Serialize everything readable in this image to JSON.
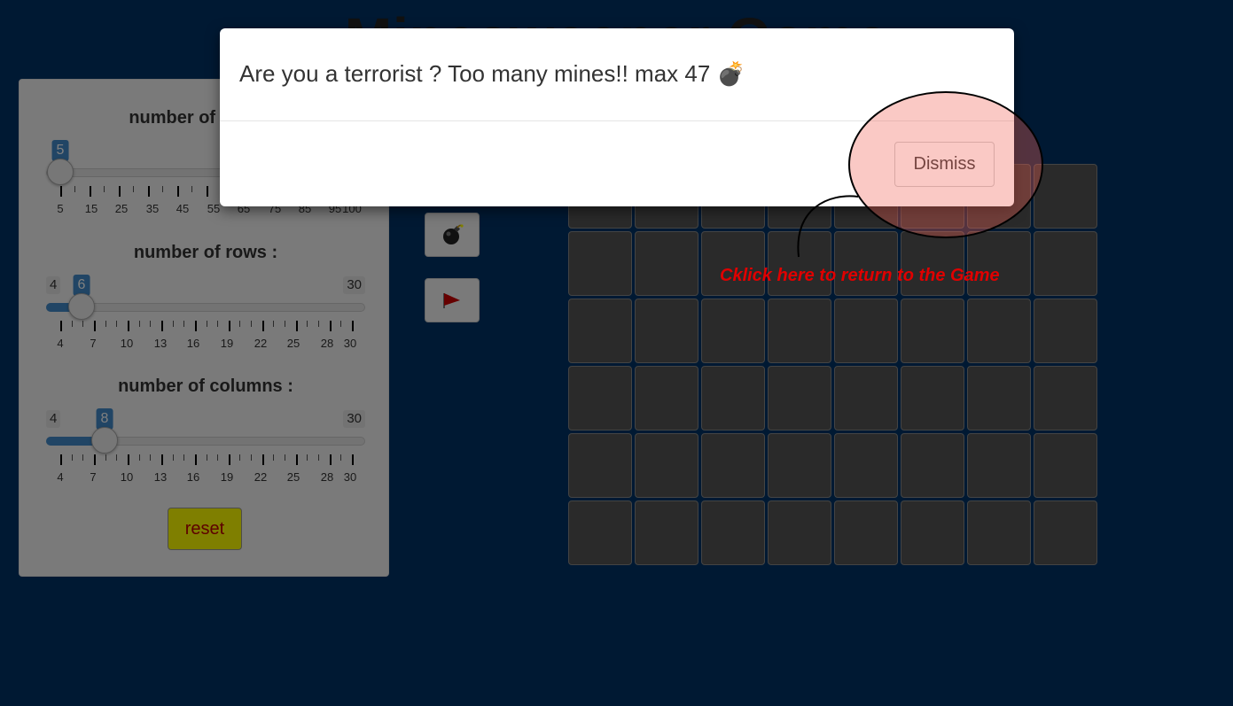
{
  "page": {
    "title": "Minesweeper Game"
  },
  "controls": {
    "mines": {
      "label": "number of mines :",
      "min": 5,
      "max": 100,
      "value": 5,
      "value_label": "5",
      "tick_labels": [
        "5",
        "15",
        "25",
        "35",
        "45",
        "55",
        "65",
        "75",
        "85",
        "95",
        "100"
      ]
    },
    "rows": {
      "label": "number of rows :",
      "min": 4,
      "max": 30,
      "value": 6,
      "min_label": "4",
      "max_label": "30",
      "value_label": "6",
      "tick_labels": [
        "4",
        "7",
        "10",
        "13",
        "16",
        "19",
        "22",
        "25",
        "28",
        "30"
      ]
    },
    "columns": {
      "label": "number of columns :",
      "min": 4,
      "max": 30,
      "value": 8,
      "min_label": "4",
      "max_label": "30",
      "value_label": "8",
      "tick_labels": [
        "4",
        "7",
        "10",
        "13",
        "16",
        "19",
        "22",
        "25",
        "28",
        "30"
      ]
    },
    "reset_label": "reset"
  },
  "modes": {
    "bomb_icon": "bomb-icon",
    "flag_icon": "flag-icon"
  },
  "board": {
    "rows": 6,
    "columns": 8
  },
  "modal": {
    "message": "Are you a terrorist ? Too many mines!! max 47 💣",
    "dismiss_label": "Dismiss"
  },
  "annotation": {
    "text": "Cklick here to return to the Game"
  },
  "colors": {
    "background": "#003366",
    "slider_accent": "#428bca",
    "reset_bg": "#ffff00",
    "reset_text": "#bb0000",
    "annotation_text": "#e00000"
  }
}
